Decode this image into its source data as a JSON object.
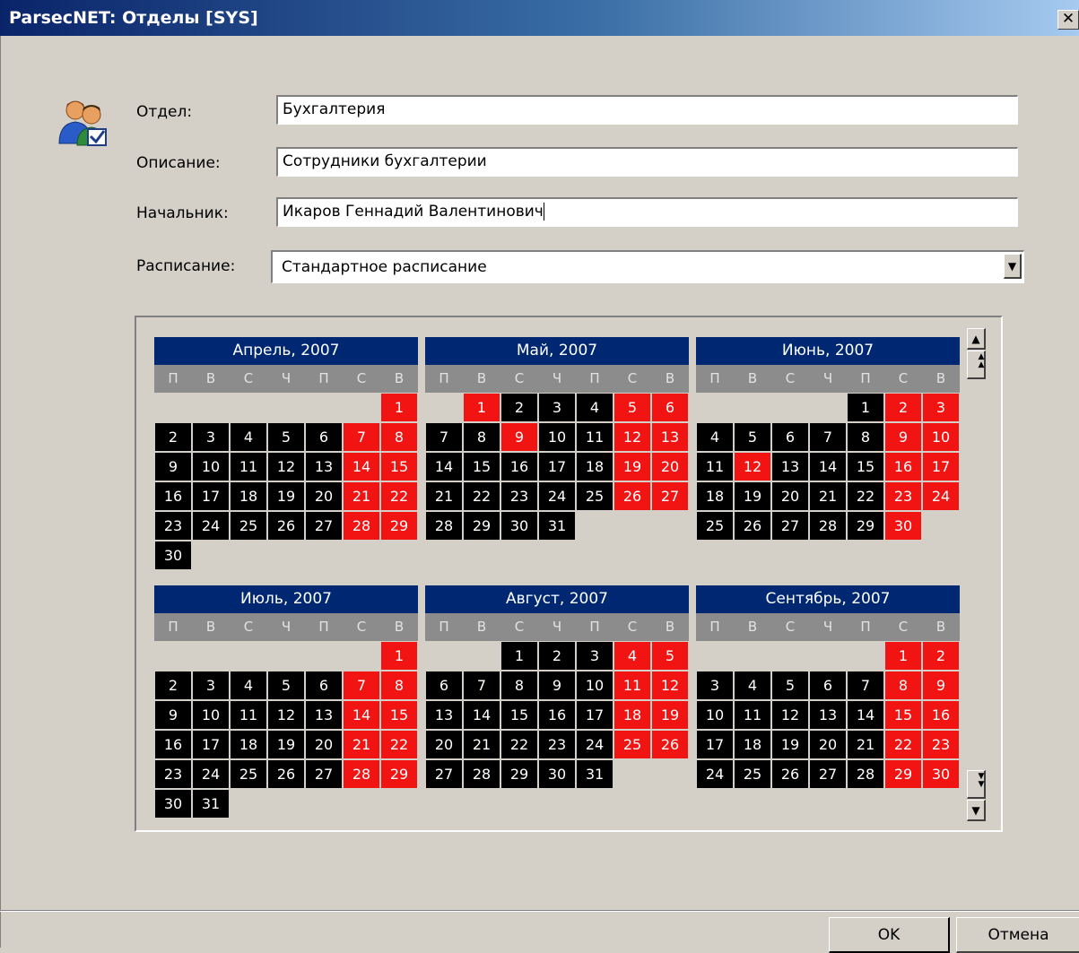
{
  "window": {
    "title": "ParsecNET: Отделы [SYS]",
    "close_glyph": "✕"
  },
  "form": {
    "department_label": "Отдел:",
    "department_value": "Бухгалтерия",
    "description_label": "Описание:",
    "description_value": "Сотрудники бухгалтерии",
    "head_label": "Начальник:",
    "head_value": "Икаров Геннадий Валентинович",
    "schedule_label": "Расписание:",
    "schedule_value": "Стандартное расписание"
  },
  "icons": {
    "department_icon": "users-check-icon",
    "dropdown_icon": "chevron-down-icon",
    "scroll_up_icon": "scroll-up-icon",
    "scroll_page_up_icon": "scroll-page-up-icon",
    "scroll_page_down_icon": "scroll-page-down-icon",
    "scroll_down_icon": "scroll-down-icon"
  },
  "calendar": {
    "weekdays": [
      "П",
      "В",
      "С",
      "Ч",
      "П",
      "С",
      "В"
    ],
    "colors": {
      "header": "#002872",
      "weekday_bar": "#8c8c8c",
      "workday": "#000000",
      "holiday": "#f21313"
    },
    "months": [
      {
        "title": "Апрель, 2007",
        "days": [
          {
            "n": "",
            "t": "e"
          },
          {
            "n": "",
            "t": "e"
          },
          {
            "n": "",
            "t": "e"
          },
          {
            "n": "",
            "t": "e"
          },
          {
            "n": "",
            "t": "e"
          },
          {
            "n": "",
            "t": "e"
          },
          {
            "n": "1",
            "t": "h"
          },
          {
            "n": "2",
            "t": "w"
          },
          {
            "n": "3",
            "t": "w"
          },
          {
            "n": "4",
            "t": "w"
          },
          {
            "n": "5",
            "t": "w"
          },
          {
            "n": "6",
            "t": "w"
          },
          {
            "n": "7",
            "t": "h"
          },
          {
            "n": "8",
            "t": "h"
          },
          {
            "n": "9",
            "t": "w"
          },
          {
            "n": "10",
            "t": "w"
          },
          {
            "n": "11",
            "t": "w"
          },
          {
            "n": "12",
            "t": "w"
          },
          {
            "n": "13",
            "t": "w"
          },
          {
            "n": "14",
            "t": "h"
          },
          {
            "n": "15",
            "t": "h"
          },
          {
            "n": "16",
            "t": "w"
          },
          {
            "n": "17",
            "t": "w"
          },
          {
            "n": "18",
            "t": "w"
          },
          {
            "n": "19",
            "t": "w"
          },
          {
            "n": "20",
            "t": "w"
          },
          {
            "n": "21",
            "t": "h"
          },
          {
            "n": "22",
            "t": "h"
          },
          {
            "n": "23",
            "t": "w"
          },
          {
            "n": "24",
            "t": "w"
          },
          {
            "n": "25",
            "t": "w"
          },
          {
            "n": "26",
            "t": "w"
          },
          {
            "n": "27",
            "t": "w"
          },
          {
            "n": "28",
            "t": "h"
          },
          {
            "n": "29",
            "t": "h"
          },
          {
            "n": "30",
            "t": "w"
          }
        ]
      },
      {
        "title": "Май, 2007",
        "days": [
          {
            "n": "",
            "t": "e"
          },
          {
            "n": "1",
            "t": "h"
          },
          {
            "n": "2",
            "t": "w"
          },
          {
            "n": "3",
            "t": "w"
          },
          {
            "n": "4",
            "t": "w"
          },
          {
            "n": "5",
            "t": "h"
          },
          {
            "n": "6",
            "t": "h"
          },
          {
            "n": "7",
            "t": "w"
          },
          {
            "n": "8",
            "t": "w"
          },
          {
            "n": "9",
            "t": "h"
          },
          {
            "n": "10",
            "t": "w"
          },
          {
            "n": "11",
            "t": "w"
          },
          {
            "n": "12",
            "t": "h"
          },
          {
            "n": "13",
            "t": "h"
          },
          {
            "n": "14",
            "t": "w"
          },
          {
            "n": "15",
            "t": "w"
          },
          {
            "n": "16",
            "t": "w"
          },
          {
            "n": "17",
            "t": "w"
          },
          {
            "n": "18",
            "t": "w"
          },
          {
            "n": "19",
            "t": "h"
          },
          {
            "n": "20",
            "t": "h"
          },
          {
            "n": "21",
            "t": "w"
          },
          {
            "n": "22",
            "t": "w"
          },
          {
            "n": "23",
            "t": "w"
          },
          {
            "n": "24",
            "t": "w"
          },
          {
            "n": "25",
            "t": "w"
          },
          {
            "n": "26",
            "t": "h"
          },
          {
            "n": "27",
            "t": "h"
          },
          {
            "n": "28",
            "t": "w"
          },
          {
            "n": "29",
            "t": "w"
          },
          {
            "n": "30",
            "t": "w"
          },
          {
            "n": "31",
            "t": "w"
          }
        ]
      },
      {
        "title": "Июнь, 2007",
        "days": [
          {
            "n": "",
            "t": "e"
          },
          {
            "n": "",
            "t": "e"
          },
          {
            "n": "",
            "t": "e"
          },
          {
            "n": "",
            "t": "e"
          },
          {
            "n": "1",
            "t": "w"
          },
          {
            "n": "2",
            "t": "h"
          },
          {
            "n": "3",
            "t": "h"
          },
          {
            "n": "4",
            "t": "w"
          },
          {
            "n": "5",
            "t": "w"
          },
          {
            "n": "6",
            "t": "w"
          },
          {
            "n": "7",
            "t": "w"
          },
          {
            "n": "8",
            "t": "w"
          },
          {
            "n": "9",
            "t": "h"
          },
          {
            "n": "10",
            "t": "h"
          },
          {
            "n": "11",
            "t": "w"
          },
          {
            "n": "12",
            "t": "h"
          },
          {
            "n": "13",
            "t": "w"
          },
          {
            "n": "14",
            "t": "w"
          },
          {
            "n": "15",
            "t": "w"
          },
          {
            "n": "16",
            "t": "h"
          },
          {
            "n": "17",
            "t": "h"
          },
          {
            "n": "18",
            "t": "w"
          },
          {
            "n": "19",
            "t": "w"
          },
          {
            "n": "20",
            "t": "w"
          },
          {
            "n": "21",
            "t": "w"
          },
          {
            "n": "22",
            "t": "w"
          },
          {
            "n": "23",
            "t": "h"
          },
          {
            "n": "24",
            "t": "h"
          },
          {
            "n": "25",
            "t": "w"
          },
          {
            "n": "26",
            "t": "w"
          },
          {
            "n": "27",
            "t": "w"
          },
          {
            "n": "28",
            "t": "w"
          },
          {
            "n": "29",
            "t": "w"
          },
          {
            "n": "30",
            "t": "h"
          }
        ]
      },
      {
        "title": "Июль, 2007",
        "days": [
          {
            "n": "",
            "t": "e"
          },
          {
            "n": "",
            "t": "e"
          },
          {
            "n": "",
            "t": "e"
          },
          {
            "n": "",
            "t": "e"
          },
          {
            "n": "",
            "t": "e"
          },
          {
            "n": "",
            "t": "e"
          },
          {
            "n": "1",
            "t": "h"
          },
          {
            "n": "2",
            "t": "w"
          },
          {
            "n": "3",
            "t": "w"
          },
          {
            "n": "4",
            "t": "w"
          },
          {
            "n": "5",
            "t": "w"
          },
          {
            "n": "6",
            "t": "w"
          },
          {
            "n": "7",
            "t": "h"
          },
          {
            "n": "8",
            "t": "h"
          },
          {
            "n": "9",
            "t": "w"
          },
          {
            "n": "10",
            "t": "w"
          },
          {
            "n": "11",
            "t": "w"
          },
          {
            "n": "12",
            "t": "w"
          },
          {
            "n": "13",
            "t": "w"
          },
          {
            "n": "14",
            "t": "h"
          },
          {
            "n": "15",
            "t": "h"
          },
          {
            "n": "16",
            "t": "w"
          },
          {
            "n": "17",
            "t": "w"
          },
          {
            "n": "18",
            "t": "w"
          },
          {
            "n": "19",
            "t": "w"
          },
          {
            "n": "20",
            "t": "w"
          },
          {
            "n": "21",
            "t": "h"
          },
          {
            "n": "22",
            "t": "h"
          },
          {
            "n": "23",
            "t": "w"
          },
          {
            "n": "24",
            "t": "w"
          },
          {
            "n": "25",
            "t": "w"
          },
          {
            "n": "26",
            "t": "w"
          },
          {
            "n": "27",
            "t": "w"
          },
          {
            "n": "28",
            "t": "h"
          },
          {
            "n": "29",
            "t": "h"
          },
          {
            "n": "30",
            "t": "w"
          },
          {
            "n": "31",
            "t": "w"
          }
        ]
      },
      {
        "title": "Август, 2007",
        "days": [
          {
            "n": "",
            "t": "e"
          },
          {
            "n": "",
            "t": "e"
          },
          {
            "n": "1",
            "t": "w"
          },
          {
            "n": "2",
            "t": "w"
          },
          {
            "n": "3",
            "t": "w"
          },
          {
            "n": "4",
            "t": "h"
          },
          {
            "n": "5",
            "t": "h"
          },
          {
            "n": "6",
            "t": "w"
          },
          {
            "n": "7",
            "t": "w"
          },
          {
            "n": "8",
            "t": "w"
          },
          {
            "n": "9",
            "t": "w"
          },
          {
            "n": "10",
            "t": "w"
          },
          {
            "n": "11",
            "t": "h"
          },
          {
            "n": "12",
            "t": "h"
          },
          {
            "n": "13",
            "t": "w"
          },
          {
            "n": "14",
            "t": "w"
          },
          {
            "n": "15",
            "t": "w"
          },
          {
            "n": "16",
            "t": "w"
          },
          {
            "n": "17",
            "t": "w"
          },
          {
            "n": "18",
            "t": "h"
          },
          {
            "n": "19",
            "t": "h"
          },
          {
            "n": "20",
            "t": "w"
          },
          {
            "n": "21",
            "t": "w"
          },
          {
            "n": "22",
            "t": "w"
          },
          {
            "n": "23",
            "t": "w"
          },
          {
            "n": "24",
            "t": "w"
          },
          {
            "n": "25",
            "t": "h"
          },
          {
            "n": "26",
            "t": "h"
          },
          {
            "n": "27",
            "t": "w"
          },
          {
            "n": "28",
            "t": "w"
          },
          {
            "n": "29",
            "t": "w"
          },
          {
            "n": "30",
            "t": "w"
          },
          {
            "n": "31",
            "t": "w"
          }
        ]
      },
      {
        "title": "Сентябрь, 2007",
        "days": [
          {
            "n": "",
            "t": "e"
          },
          {
            "n": "",
            "t": "e"
          },
          {
            "n": "",
            "t": "e"
          },
          {
            "n": "",
            "t": "e"
          },
          {
            "n": "",
            "t": "e"
          },
          {
            "n": "1",
            "t": "h"
          },
          {
            "n": "2",
            "t": "h"
          },
          {
            "n": "3",
            "t": "w"
          },
          {
            "n": "4",
            "t": "w"
          },
          {
            "n": "5",
            "t": "w"
          },
          {
            "n": "6",
            "t": "w"
          },
          {
            "n": "7",
            "t": "w"
          },
          {
            "n": "8",
            "t": "h"
          },
          {
            "n": "9",
            "t": "h"
          },
          {
            "n": "10",
            "t": "w"
          },
          {
            "n": "11",
            "t": "w"
          },
          {
            "n": "12",
            "t": "w"
          },
          {
            "n": "13",
            "t": "w"
          },
          {
            "n": "14",
            "t": "w"
          },
          {
            "n": "15",
            "t": "h"
          },
          {
            "n": "16",
            "t": "h"
          },
          {
            "n": "17",
            "t": "w"
          },
          {
            "n": "18",
            "t": "w"
          },
          {
            "n": "19",
            "t": "w"
          },
          {
            "n": "20",
            "t": "w"
          },
          {
            "n": "21",
            "t": "w"
          },
          {
            "n": "22",
            "t": "h"
          },
          {
            "n": "23",
            "t": "h"
          },
          {
            "n": "24",
            "t": "w"
          },
          {
            "n": "25",
            "t": "w"
          },
          {
            "n": "26",
            "t": "w"
          },
          {
            "n": "27",
            "t": "w"
          },
          {
            "n": "28",
            "t": "w"
          },
          {
            "n": "29",
            "t": "h"
          },
          {
            "n": "30",
            "t": "h"
          }
        ]
      }
    ]
  },
  "scroll": {
    "up": "▲",
    "page_up": "▲▲",
    "page_down": "▼▼",
    "down": "▼"
  },
  "dropdown_glyph": "▼",
  "buttons": {
    "ok_label": "OK",
    "cancel_label": "Отмена"
  }
}
